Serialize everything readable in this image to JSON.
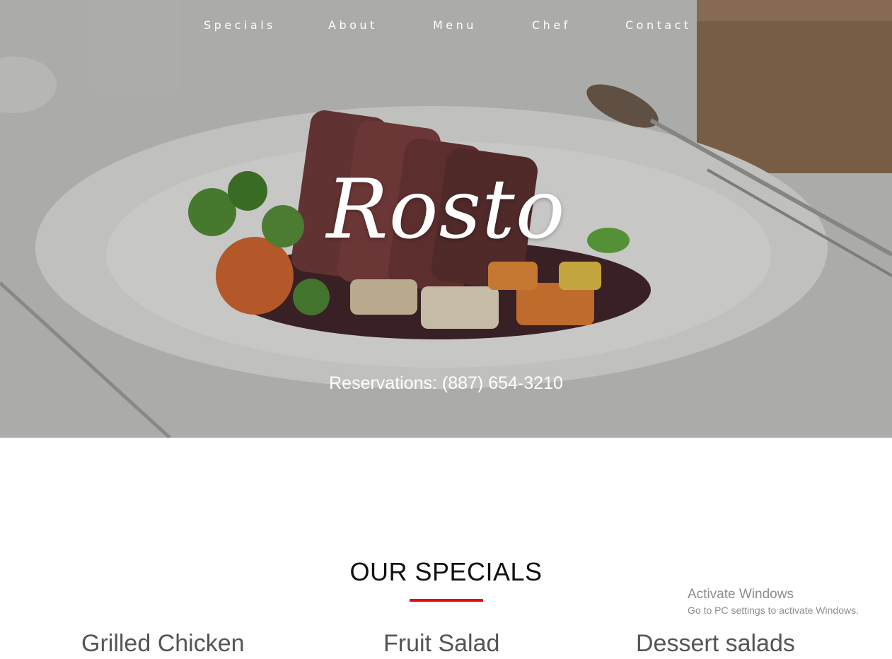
{
  "nav": {
    "items": [
      {
        "label": "Specials"
      },
      {
        "label": "About"
      },
      {
        "label": "Menu"
      },
      {
        "label": "Chef"
      },
      {
        "label": "Contact"
      }
    ]
  },
  "hero": {
    "brand": "Rosto",
    "reservations": "Reservations: (887) 654-3210",
    "image": "plated-steak-with-vegetables"
  },
  "specials": {
    "title": "OUR SPECIALS",
    "items": [
      {
        "name": "Grilled Chicken"
      },
      {
        "name": "Fruit Salad"
      },
      {
        "name": "Dessert salads"
      }
    ]
  },
  "watermark": {
    "title": "Activate Windows",
    "subtitle": "Go to PC settings to activate Windows."
  },
  "colors": {
    "accent": "#e10c0c",
    "nav_text": "#ffffff",
    "heading": "#111111",
    "special_text": "#555555"
  }
}
